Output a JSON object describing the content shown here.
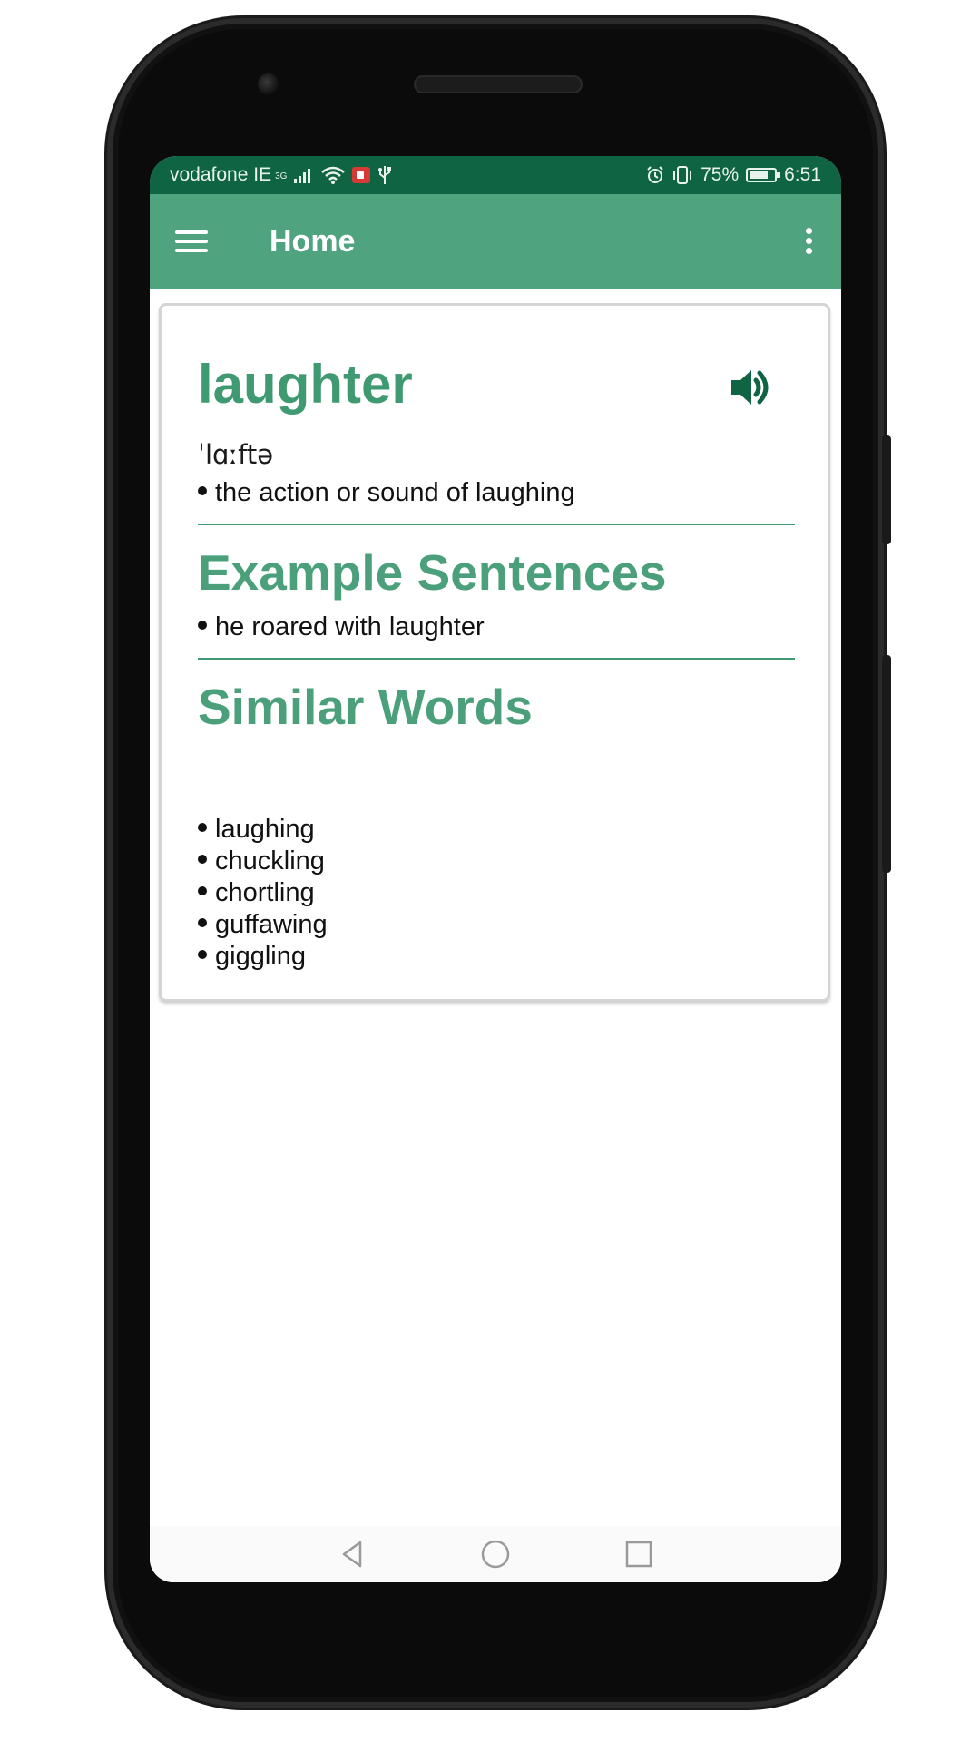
{
  "status_bar": {
    "carrier": "vodafone IE",
    "network": "3G",
    "battery_percent": "75%",
    "battery_level": 0.75,
    "time": "6:51",
    "icons": [
      "signal-icon",
      "wifi-icon",
      "screen-record-icon",
      "usb-icon",
      "alarm-icon",
      "vibrate-icon",
      "battery-icon"
    ]
  },
  "app_bar": {
    "title": "Home",
    "icons": [
      "menu-icon",
      "more-vert-icon"
    ]
  },
  "entry": {
    "word": "laughter",
    "phonetic": "ˈlɑːftə",
    "definitions": [
      "the action or sound of laughing"
    ],
    "audio_icon": "volume-up-icon"
  },
  "examples": {
    "title": "Example Sentences",
    "items": [
      "he roared with laughter"
    ]
  },
  "similar": {
    "title": "Similar Words",
    "items": [
      "laughing",
      "chuckling",
      "chortling",
      "guffawing",
      "giggling"
    ]
  },
  "nav_bar": {
    "icons": [
      "back-icon",
      "home-icon",
      "recents-icon"
    ]
  },
  "colors": {
    "status_bar": "#0f6443",
    "app_bar": "#4fa37f",
    "accent": "#3f9a72"
  }
}
